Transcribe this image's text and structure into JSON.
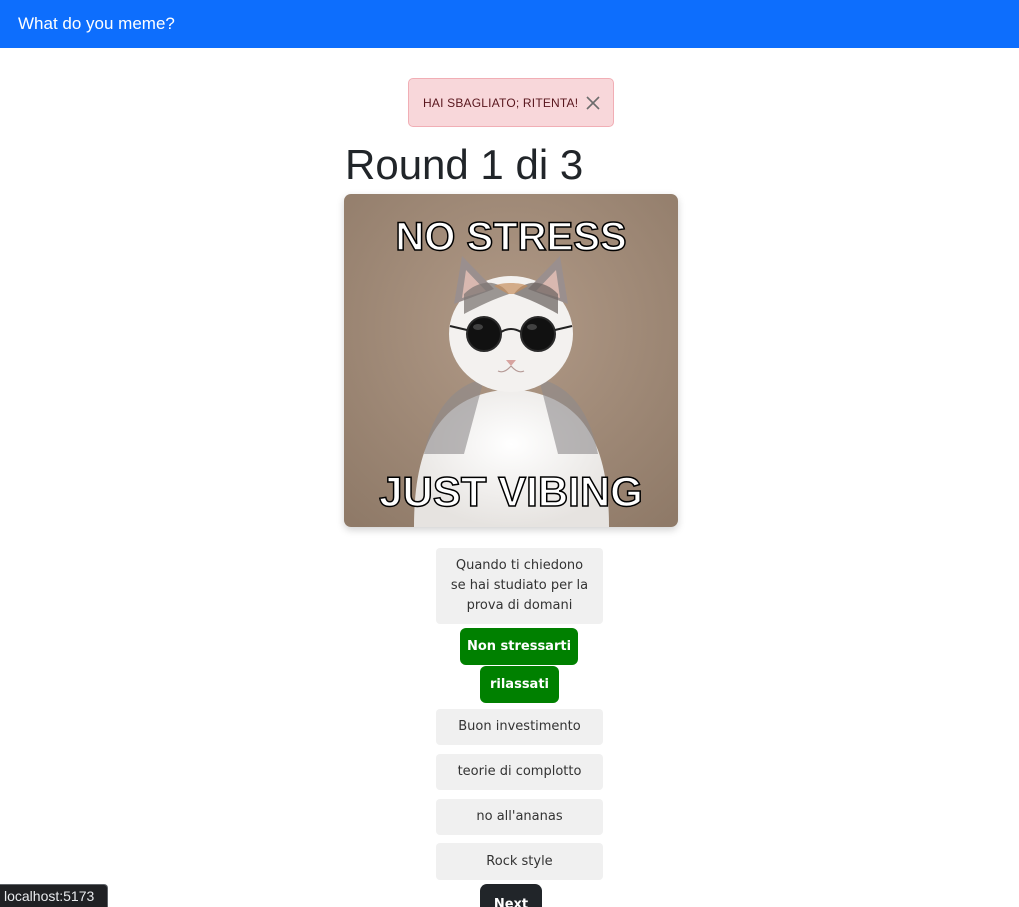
{
  "navbar": {
    "brand": "What do you meme?"
  },
  "alert": {
    "message": "HAI SBAGLIATO; RITENTA!",
    "close_icon": "close-icon"
  },
  "round": {
    "title": "Round 1 di 3"
  },
  "meme": {
    "top_text": "NO STRESS",
    "bottom_text": "JUST VIBING"
  },
  "captions": [
    {
      "label": "Quando ti chiedono se hai studiato per la prova di domani",
      "correct": false
    },
    {
      "label": "Non stressarti",
      "correct": true
    },
    {
      "label": "rilassati",
      "correct": true
    },
    {
      "label": "Buon investimento",
      "correct": false
    },
    {
      "label": "teorie di complotto",
      "correct": false
    },
    {
      "label": "no all'ananas",
      "correct": false
    },
    {
      "label": "Rock style",
      "correct": false
    }
  ],
  "next_button": {
    "label": "Next"
  },
  "status_bar": {
    "url": "localhost:5173"
  },
  "colors": {
    "navbar": "#0d6efd",
    "alert_bg": "#f8d7da",
    "correct": "#008000",
    "caption_bg": "#f0f0f0",
    "next_bg": "#212529"
  }
}
